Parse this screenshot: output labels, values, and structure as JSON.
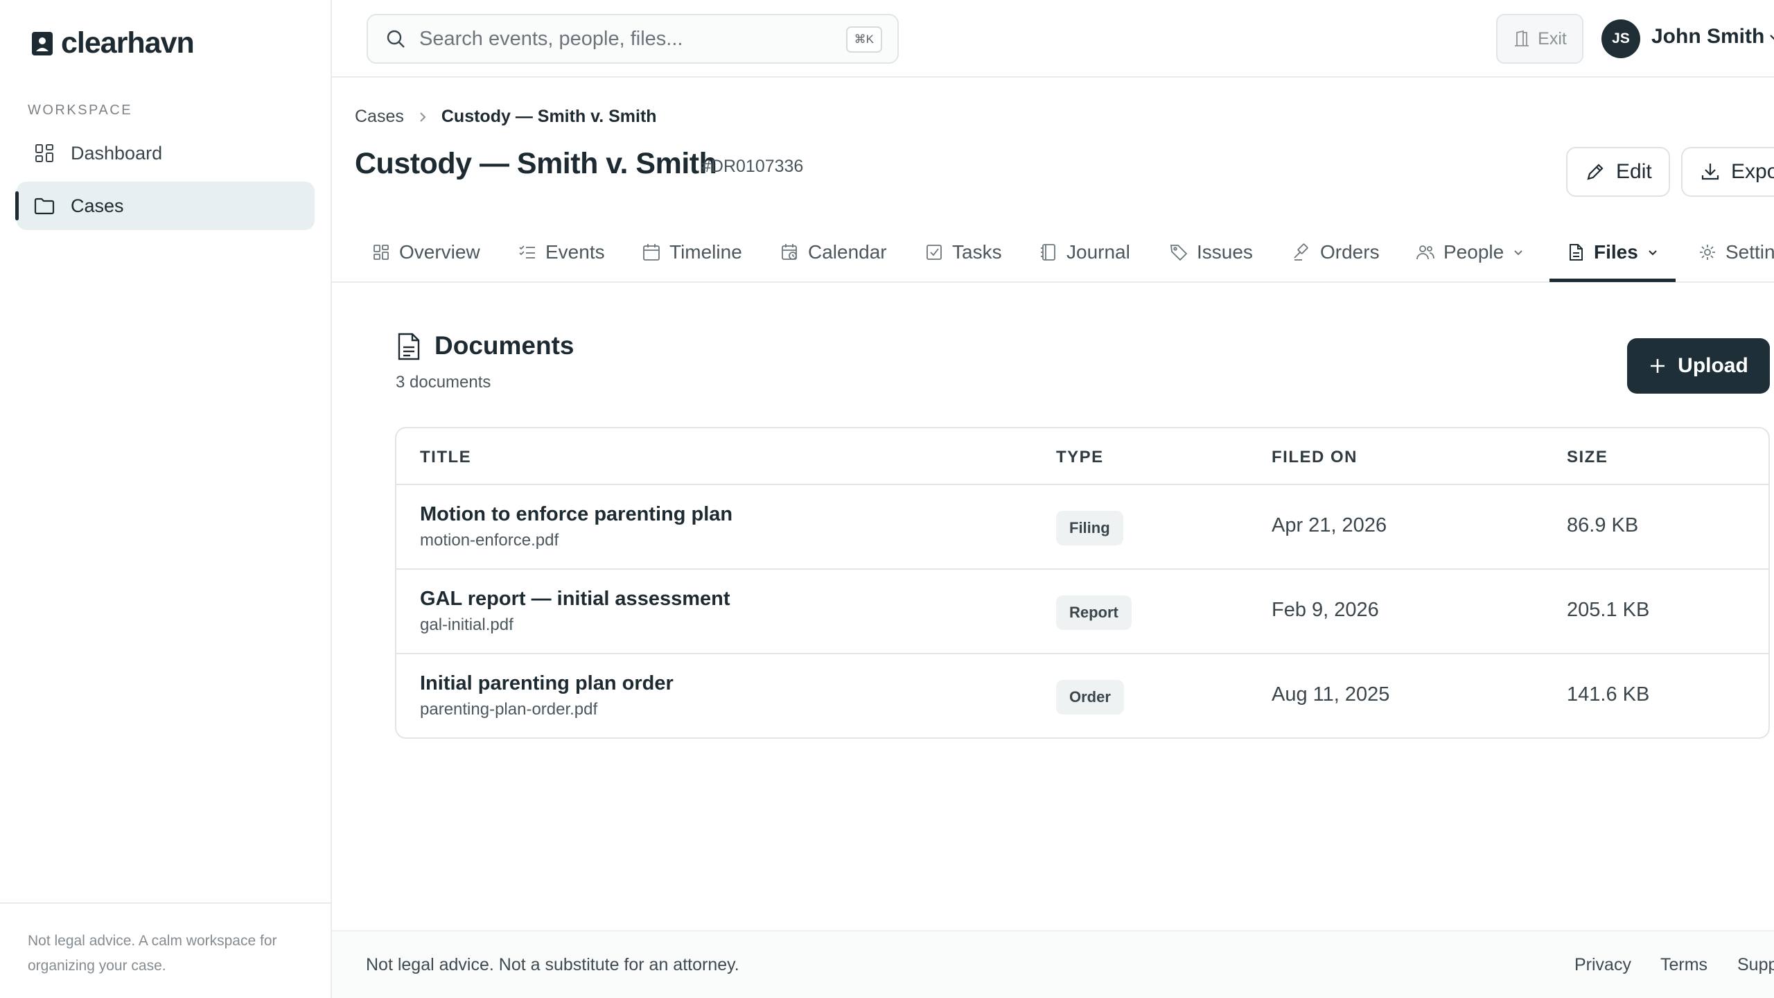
{
  "app": {
    "name": "clearhavn",
    "colors": {
      "primary": "#1e2f37",
      "accent_bg": "#e8eff1",
      "border": "#e1e5e8",
      "muted_text": "#858c91"
    }
  },
  "sidebar": {
    "section_label": "WORKSPACE",
    "items": [
      {
        "label": "Dashboard",
        "icon": "dashboard-grid-icon",
        "active": false
      },
      {
        "label": "Cases",
        "icon": "folder-icon",
        "active": true
      }
    ],
    "footer_text": "Not legal advice. A calm workspace for organizing your case."
  },
  "topbar": {
    "search": {
      "placeholder": "Search events, people, files...",
      "shortcut": "⌘K"
    },
    "exit_label": "Exit",
    "user": {
      "initials": "JS",
      "name": "John Smith"
    }
  },
  "breadcrumb": {
    "parent": "Cases",
    "current": "Custody — Smith v. Smith"
  },
  "page": {
    "title": "Custody — Smith v. Smith",
    "case_id": "#DR0107336",
    "actions": {
      "edit": "Edit",
      "export": "Export"
    }
  },
  "tabs": [
    {
      "label": "Overview",
      "icon": "overview-grid-icon"
    },
    {
      "label": "Events",
      "icon": "list-check-icon"
    },
    {
      "label": "Timeline",
      "icon": "calendar-icon"
    },
    {
      "label": "Calendar",
      "icon": "calendar-clock-icon"
    },
    {
      "label": "Tasks",
      "icon": "checkbox-icon"
    },
    {
      "label": "Journal",
      "icon": "notebook-icon"
    },
    {
      "label": "Issues",
      "icon": "tag-icon"
    },
    {
      "label": "Orders",
      "icon": "gavel-icon"
    },
    {
      "label": "People",
      "icon": "people-icon",
      "has_dropdown": true
    },
    {
      "label": "Files",
      "icon": "file-icon",
      "has_dropdown": true,
      "active": true
    },
    {
      "label": "Settings",
      "icon": "gear-icon"
    }
  ],
  "documents": {
    "title": "Documents",
    "count_text": "3 documents",
    "upload_label": "Upload",
    "columns": [
      "TITLE",
      "TYPE",
      "FILED ON",
      "SIZE"
    ],
    "rows": [
      {
        "title": "Motion to enforce parenting plan",
        "filename": "motion-enforce.pdf",
        "type": "Filing",
        "filed_on": "Apr 21, 2026",
        "size": "86.9 KB"
      },
      {
        "title": "GAL report — initial assessment",
        "filename": "gal-initial.pdf",
        "type": "Report",
        "filed_on": "Feb 9, 2026",
        "size": "205.1 KB"
      },
      {
        "title": "Initial parenting plan order",
        "filename": "parenting-plan-order.pdf",
        "type": "Order",
        "filed_on": "Aug 11, 2025",
        "size": "141.6 KB"
      }
    ]
  },
  "footer": {
    "note": "Not legal advice. Not a substitute for an attorney.",
    "links": [
      "Privacy",
      "Terms",
      "Support"
    ]
  }
}
